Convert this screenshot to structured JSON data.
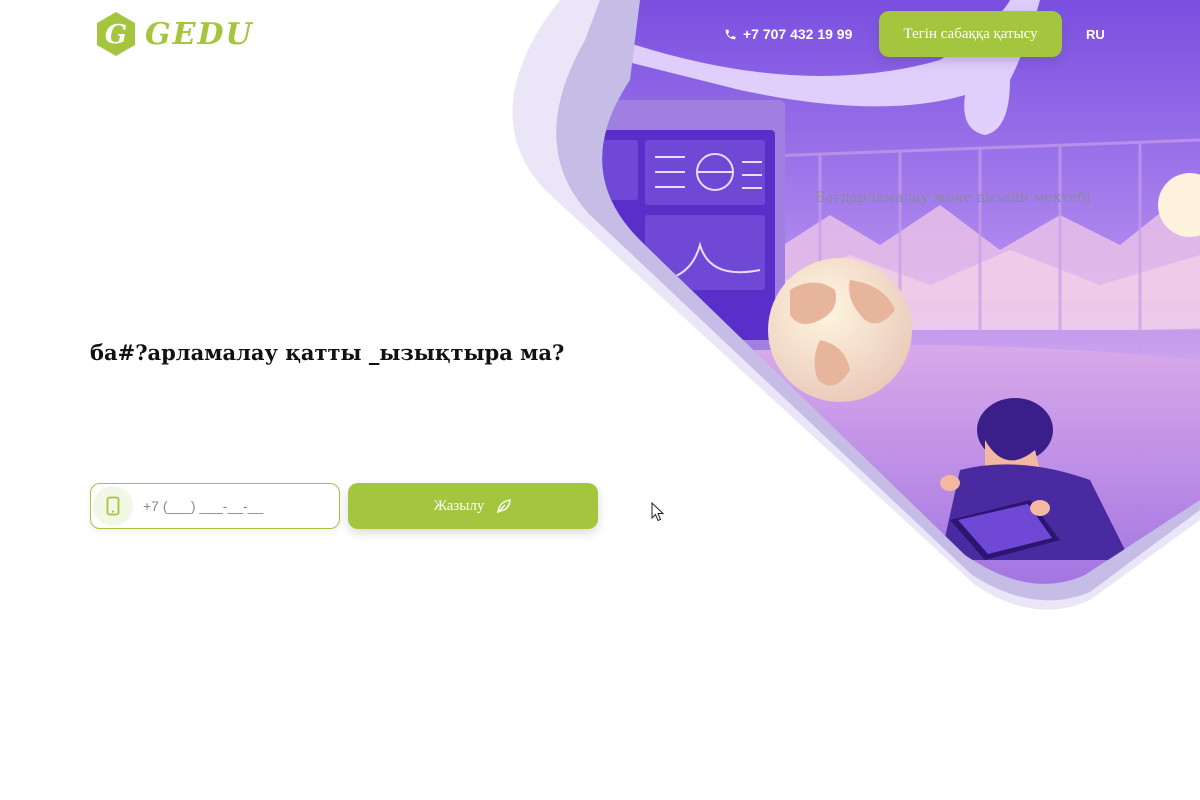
{
  "header": {
    "logo_text": "GEDU",
    "phone": "+7 707 432 19 99",
    "trial_button_label": "Тегін сабаққа қатысу",
    "lang_label": "RU"
  },
  "hero": {
    "tagline": "Бағдарламалау және дизайн мектебі",
    "heading": "ба#?арламалау қатты _ызықтыра ма?",
    "phone_input": {
      "placeholder": "+7 (___) ___-__-__",
      "value": ""
    },
    "submit_label": "Жазылу"
  },
  "colors": {
    "accent": "#a4c53e",
    "illustration_purple": "#8a5ee0",
    "frame_lavender": "#c6bde6"
  },
  "icons": {
    "phone": "phone-icon",
    "mobile": "mobile-phone-icon",
    "submit": "leaf-icon",
    "logo": "hexagon-g-logo-icon"
  }
}
